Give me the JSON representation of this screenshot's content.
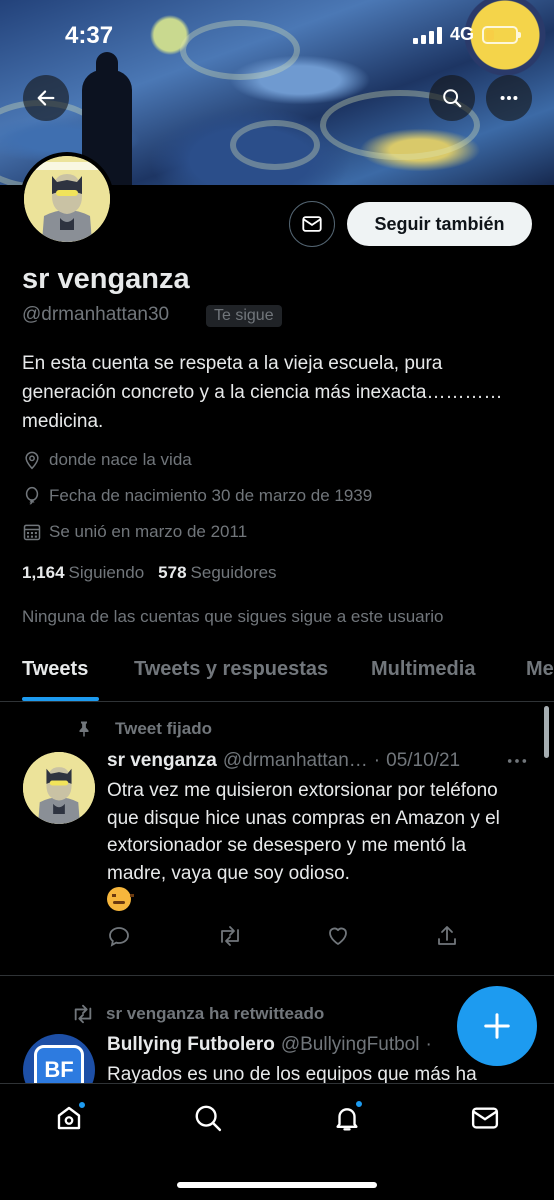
{
  "status_bar": {
    "time": "4:37",
    "network": "4G"
  },
  "profile": {
    "name": "sr venganza",
    "handle": "@drmanhattan30",
    "follows_you": "Te sigue",
    "follow_button": "Seguir también",
    "bio": "En esta cuenta se respeta a la vieja escuela, pura generación concreto y a la ciencia más inexacta………… medicina.",
    "location": "donde nace la vida",
    "birthday": "Fecha de nacimiento 30 de marzo de 1939",
    "joined": "Se unió en marzo de 2011",
    "following_count": "1,164",
    "following_label": "Siguiendo",
    "followers_count": "578",
    "followers_label": "Seguidores",
    "mutual_notice": "Ninguna de las cuentas que sigues sigue a este usuario"
  },
  "tabs": [
    {
      "label": "Tweets",
      "active": true
    },
    {
      "label": "Tweets y respuestas",
      "active": false
    },
    {
      "label": "Multimedia",
      "active": false
    },
    {
      "label": "Me",
      "active": false
    }
  ],
  "pinned_tweet": {
    "context": "Tweet fijado",
    "name": "sr venganza",
    "handle": "@drmanhattan…",
    "separator": "·",
    "date": "05/10/21",
    "text": "Otra vez me quisieron extorsionar por teléfono que disque hice unas compras en Amazon y el extorsionador se desespero y me mentó la madre, vaya que soy odioso."
  },
  "retweet": {
    "context": "sr venganza ha retwitteado",
    "name": "Bullying Futbolero",
    "handle": "@BullyingFutbol",
    "separator": "·",
    "text": "Rayados es uno de los equipos que más ha",
    "avatar_initials": "BF"
  },
  "colors": {
    "accent": "#1d9bf0",
    "muted": "#71767b",
    "text": "#e7e9ea",
    "background": "#000000"
  }
}
